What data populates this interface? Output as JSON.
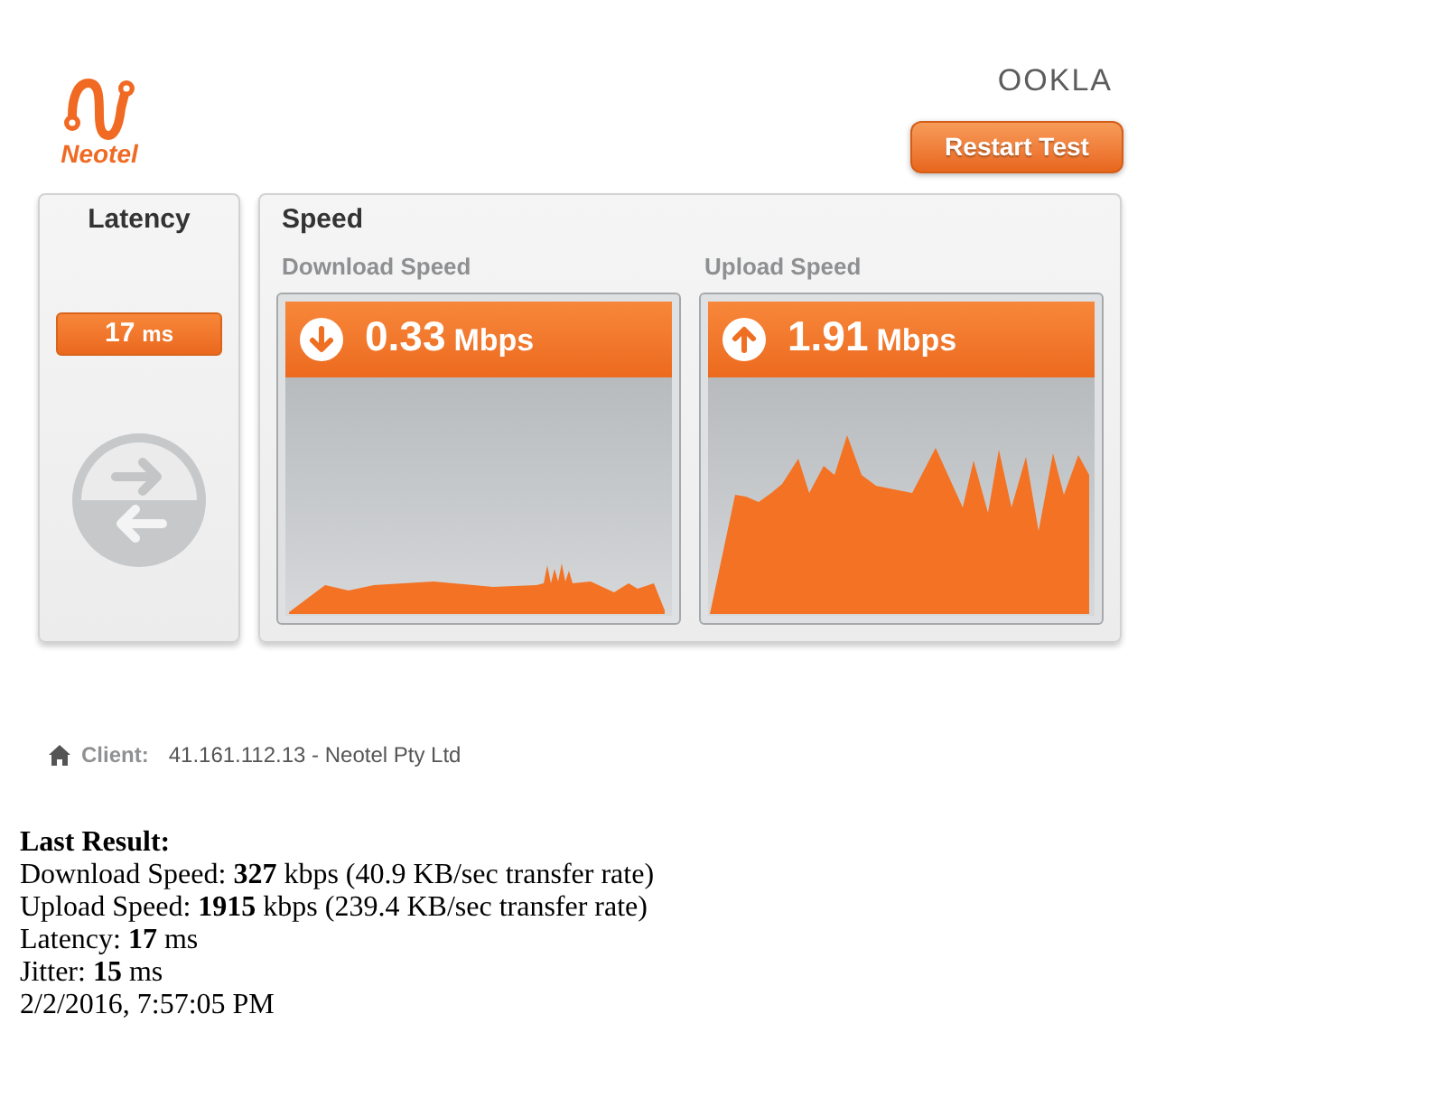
{
  "header": {
    "logo_text": "Neotel",
    "brand_text": "OOKLA",
    "restart_button": "Restart Test"
  },
  "latency": {
    "title": "Latency",
    "value": "17",
    "unit": "ms"
  },
  "speed": {
    "title": "Speed",
    "tests": [
      {
        "kind": "download",
        "label": "Download Speed",
        "value": "0.33",
        "unit": "Mbps"
      },
      {
        "kind": "upload",
        "label": "Upload Speed",
        "value": "1.91",
        "unit": "Mbps"
      }
    ]
  },
  "client": {
    "label": "Client:",
    "value": "41.161.112.13 - Neotel Pty Ltd"
  },
  "last_result": {
    "title": "Last Result:",
    "lines": [
      "Download Speed: **327** kbps (40.9 KB/sec transfer rate)",
      "Upload Speed: **1915** kbps (239.4 KB/sec transfer rate)",
      "Latency: **17** ms",
      "Jitter: **15** ms"
    ],
    "timestamp": "2/2/2016, 7:57:05 PM"
  }
}
